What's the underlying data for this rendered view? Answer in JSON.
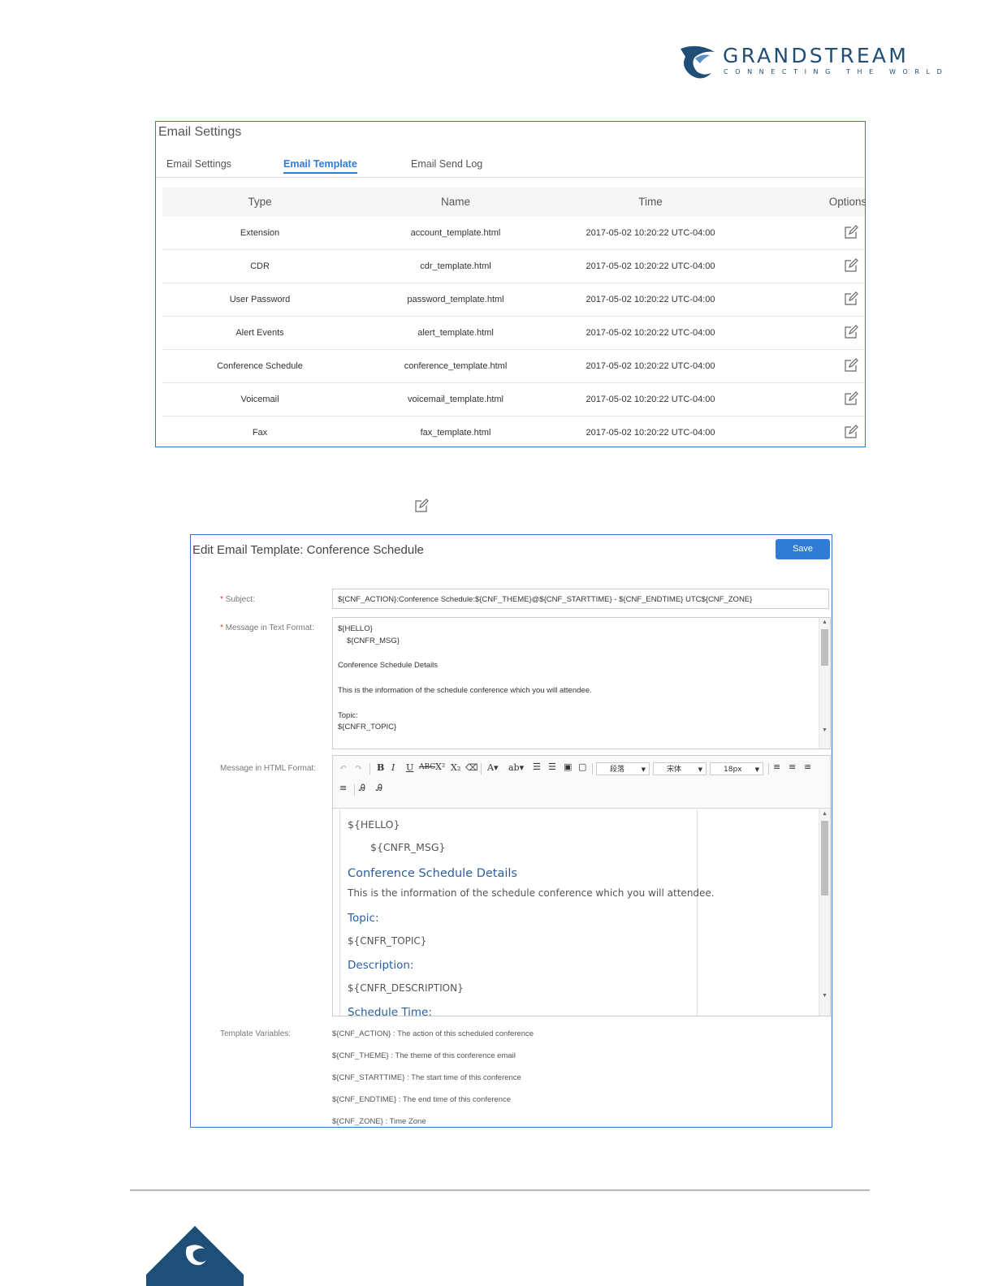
{
  "logo": {
    "brand": "GRANDSTREAM",
    "tagline": "CONNECTING THE WORLD",
    "colors": {
      "primary": "#1f4e79"
    }
  },
  "panel1": {
    "title": "Email Settings",
    "tabs": [
      {
        "label": "Email Settings",
        "active": false
      },
      {
        "label": "Email Template",
        "active": true
      },
      {
        "label": "Email Send Log",
        "active": false
      }
    ],
    "columns": [
      "Type",
      "Name",
      "Time",
      "Options"
    ],
    "rows": [
      {
        "type": "Extension",
        "name": "account_template.html",
        "time": "2017-05-02 10:20:22 UTC-04:00",
        "option_icon": "edit-icon"
      },
      {
        "type": "CDR",
        "name": "cdr_template.html",
        "time": "2017-05-02 10:20:22 UTC-04:00",
        "option_icon": "edit-icon"
      },
      {
        "type": "User Password",
        "name": "password_template.html",
        "time": "2017-05-02 10:20:22 UTC-04:00",
        "option_icon": "edit-icon"
      },
      {
        "type": "Alert Events",
        "name": "alert_template.html",
        "time": "2017-05-02 10:20:22 UTC-04:00",
        "option_icon": "edit-icon"
      },
      {
        "type": "Conference Schedule",
        "name": "conference_template.html",
        "time": "2017-05-02 10:20:22 UTC-04:00",
        "option_icon": "edit-icon"
      },
      {
        "type": "Voicemail",
        "name": "voicemail_template.html",
        "time": "2017-05-02 10:20:22 UTC-04:00",
        "option_icon": "edit-icon"
      },
      {
        "type": "Fax",
        "name": "fax_template.html",
        "time": "2017-05-02 10:20:22 UTC-04:00",
        "option_icon": "edit-icon"
      }
    ]
  },
  "panel2": {
    "title": "Edit Email Template: Conference Schedule",
    "save_label": "Save",
    "subject_label": "Subject:",
    "subject_value": "${CNF_ACTION}:Conference Schedule:${CNF_THEME}@${CNF_STARTTIME} - ${CNF_ENDTIME} UTC${CNF_ZONE}",
    "text_format_label": "Message in Text Format:",
    "text_lines": [
      "${HELLO}",
      "${CNFR_MSG}",
      "Conference Schedule Details",
      "This is the information of the schedule conference which you will attendee.",
      "Topic:",
      "${CNFR_TOPIC}"
    ],
    "html_format_label": "Message in HTML Format:",
    "toolbar": {
      "paragraph": "段落",
      "font": "宋体",
      "size": "18px"
    },
    "html_lines": [
      "${HELLO}",
      "${CNFR_MSG}",
      "Conference Schedule Details",
      "This is the information of the schedule conference which you will attendee.",
      "Topic:",
      "${CNFR_TOPIC}",
      "Description:",
      "${CNFR_DESCRIPTION}",
      "Schedule Time:"
    ],
    "variables_label": "Template Variables:",
    "variables": [
      "${CNF_ACTION} : The action of this scheduled conference",
      "${CNF_THEME} : The theme of this conference email",
      "${CNF_STARTTIME} : The start time of this conference",
      "${CNF_ENDTIME} : The end time of this conference",
      "${CNF_ZONE} : Time Zone"
    ],
    "colors": {
      "accent": "#2f7bd6",
      "required": "#e0302f",
      "heading": "#2a5fa0"
    }
  }
}
